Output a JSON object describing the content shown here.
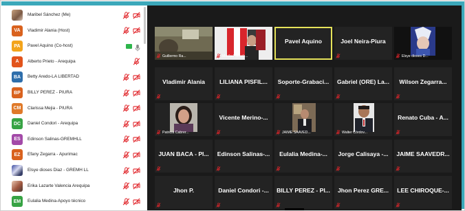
{
  "colors": {
    "accent": "#3ca8ba",
    "gallery_bg": "#1a1a1a",
    "tile_bg": "#232323",
    "active_border": "#e6e35a",
    "mute_red": "#e0252a"
  },
  "participants": [
    {
      "name": "Maribel Sánchez (Me)",
      "avatar_text": "",
      "avatar_color": "",
      "avatar_kind": "photo",
      "video": "off",
      "audio": "muted"
    },
    {
      "name": "Vladimir Alania (Host)",
      "avatar_text": "VA",
      "avatar_color": "#d9621e",
      "avatar_kind": "initials",
      "video": "off",
      "audio": "muted"
    },
    {
      "name": "Pavel Aquino (Co-host)",
      "avatar_text": "PA",
      "avatar_color": "#f3a41b",
      "avatar_kind": "initials",
      "video": "on",
      "audio": "on"
    },
    {
      "name": "Alberto Prieto - Arequipa",
      "avatar_text": "A",
      "avatar_color": "#e2541c",
      "avatar_kind": "initials",
      "video": "none",
      "audio": "muted"
    },
    {
      "name": "Betty Aredo-LA LIBERTAD",
      "avatar_text": "BA",
      "avatar_color": "#2e6eab",
      "avatar_kind": "initials",
      "video": "off",
      "audio": "muted"
    },
    {
      "name": "BILLY PEREZ - PIURA",
      "avatar_text": "BP",
      "avatar_color": "#d9621e",
      "avatar_kind": "initials",
      "video": "off",
      "audio": "muted"
    },
    {
      "name": "Clarissa Mejia - PIURA",
      "avatar_text": "CM",
      "avatar_color": "#e07a2a",
      "avatar_kind": "initials",
      "video": "off",
      "audio": "muted"
    },
    {
      "name": "Daniel Condori - Arequipa",
      "avatar_text": "DC",
      "avatar_color": "#37a344",
      "avatar_kind": "initials",
      "video": "off",
      "audio": "muted"
    },
    {
      "name": "Edinson Salinas-GREMHLL",
      "avatar_text": "ES",
      "avatar_color": "#a34aa8",
      "avatar_kind": "initials",
      "video": "off",
      "audio": "muted"
    },
    {
      "name": "Efany Zegarra - Apurimac",
      "avatar_text": "EZ",
      "avatar_color": "#d9621e",
      "avatar_kind": "initials",
      "video": "off",
      "audio": "muted"
    },
    {
      "name": "Elsye dioses Diaz - GREMH LL",
      "avatar_text": "",
      "avatar_color": "",
      "avatar_kind": "anime",
      "video": "off",
      "audio": "muted"
    },
    {
      "name": "Erika Lazarte Valencia Arequipa",
      "avatar_text": "",
      "avatar_color": "",
      "avatar_kind": "photo2",
      "video": "off",
      "audio": "muted"
    },
    {
      "name": "Eulalia Medina-Apoyo técnico",
      "avatar_text": "EM",
      "avatar_color": "#37a344",
      "avatar_kind": "initials",
      "video": "off",
      "audio": "muted"
    }
  ],
  "tiles": [
    {
      "kind": "video",
      "scene": "room",
      "label": "Guillermo Ra...",
      "name": "",
      "active": false
    },
    {
      "kind": "video",
      "scene": "flag",
      "label": "Maribel Sanch...",
      "name": "",
      "active": false
    },
    {
      "kind": "name",
      "name": "Pavel Aquino",
      "label": "",
      "active": true
    },
    {
      "kind": "name",
      "name": "Joel Neira-Piura",
      "label": "",
      "active": false
    },
    {
      "kind": "video",
      "scene": "anime",
      "label": "Elsye dioses D...",
      "name": "",
      "active": false
    },
    {
      "kind": "name",
      "name": "Vladimir Alania",
      "label": "",
      "active": false
    },
    {
      "kind": "name",
      "name": "LILIANA PISFIL...",
      "label": "",
      "active": false
    },
    {
      "kind": "name",
      "name": "Soporte-Grabaci...",
      "label": "",
      "active": false
    },
    {
      "kind": "name",
      "name": "Gabriel (ORE) La...",
      "label": "",
      "active": false
    },
    {
      "kind": "name",
      "name": "Wilson Zegarra...",
      "label": "",
      "active": false
    },
    {
      "kind": "video",
      "scene": "woman",
      "label": "Patricia Cabrer...",
      "name": "",
      "active": false
    },
    {
      "kind": "name",
      "name": "Vicente Merino-...",
      "label": "",
      "active": false
    },
    {
      "kind": "video",
      "scene": "office",
      "label": "JAIME SAAVED...",
      "name": "",
      "active": false
    },
    {
      "kind": "video",
      "scene": "man",
      "label": "Walter Córdov...",
      "name": "",
      "active": false
    },
    {
      "kind": "name",
      "name": "Renato Cuba - A...",
      "label": "",
      "active": false
    },
    {
      "kind": "name",
      "name": "JUAN BACA - PI...",
      "label": "",
      "active": false
    },
    {
      "kind": "name",
      "name": "Edinson Salinas-...",
      "label": "",
      "active": false
    },
    {
      "kind": "name",
      "name": "Eulalia Medina-...",
      "label": "",
      "active": false
    },
    {
      "kind": "name",
      "name": "Jorge Calisaya -...",
      "label": "",
      "active": false
    },
    {
      "kind": "name",
      "name": "JAIME SAAVEDR...",
      "label": "",
      "active": false
    },
    {
      "kind": "name",
      "name": "Jhon P.",
      "label": "",
      "active": false
    },
    {
      "kind": "name",
      "name": "Daniel Condori -...",
      "label": "",
      "active": false
    },
    {
      "kind": "name",
      "name": "BILLY PEREZ - PI...",
      "label": "",
      "active": false
    },
    {
      "kind": "name",
      "name": "Jhon Perez GRE...",
      "label": "",
      "active": false
    },
    {
      "kind": "name",
      "name": "LEE CHIROQUE-...",
      "label": "",
      "active": false
    }
  ]
}
